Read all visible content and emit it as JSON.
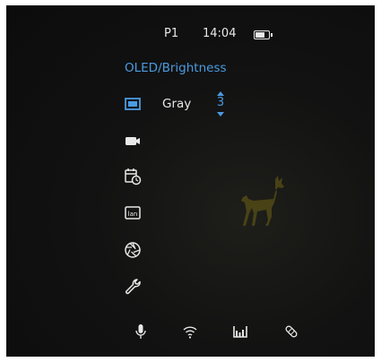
{
  "status_bar": {
    "preset": "P1",
    "time": "14:04",
    "battery_level": 0.75
  },
  "menu": {
    "title": "OLED/Brightness",
    "items": [
      {
        "icon": "display-icon",
        "active": true,
        "value": "Gray",
        "level": "3"
      },
      {
        "icon": "camera-icon"
      },
      {
        "icon": "calendar-clock-icon"
      },
      {
        "icon": "language-icon"
      },
      {
        "icon": "aperture-icon"
      },
      {
        "icon": "wrench-icon"
      }
    ]
  },
  "bottom_bar": [
    {
      "icon": "microphone-icon"
    },
    {
      "icon": "wifi-icon"
    },
    {
      "icon": "stadiametric-rangefinder-icon"
    },
    {
      "icon": "bandage-icon"
    }
  ],
  "colors": {
    "accent": "#4a9be0",
    "foreground": "#e8e8e8",
    "background": "#111111"
  }
}
